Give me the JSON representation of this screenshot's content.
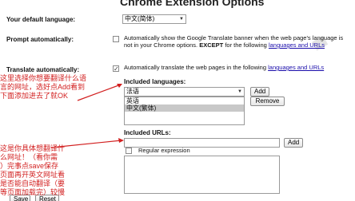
{
  "page_title": "Chrome Extension Options",
  "default_language": {
    "label": "Your default language:",
    "value": "中文(简体)"
  },
  "prompt_auto": {
    "label": "Prompt automatically:",
    "checked": false,
    "text_before": "Automatically show the Google Translate banner when the web page's language is not in your Chrome options. ",
    "emph": "EXCEPT",
    "text_mid": " for the following ",
    "link": "languages and URLs"
  },
  "translate_auto": {
    "label": "Translate automatically:",
    "checked": true,
    "text": "Automatically translate the web pages in the following ",
    "link": "languages and URLs"
  },
  "included_languages": {
    "heading": "Included languages:",
    "select_value": "法语",
    "add_button": "Add",
    "remove_button": "Remove",
    "list": [
      {
        "label": "英语",
        "selected": false
      },
      {
        "label": "中文(繁体)",
        "selected": true
      }
    ]
  },
  "included_urls": {
    "heading": "Included URLs:",
    "add_button": "Add",
    "regex_label": "Regular expression",
    "regex_checked": false
  },
  "footer": {
    "save_button": "Save",
    "reset_button": "Reset"
  },
  "annotations": {
    "top_note_lines": [
      "这里选择你想要翻译什么语",
      "言的网址，选好点Add看到",
      "下面添加进去了就OK"
    ],
    "bottom_note_lines": [
      "这是你具体想翻译什",
      "么网址！（看你需",
      "）完事点save保存",
      "页面再开英文网址看",
      "是否能自动翻译（要",
      "等页面加载完）较慢"
    ]
  },
  "colors": {
    "annotation": "#d21f1f",
    "link": "#1a0dab",
    "selected_row": "#c8c8c8"
  }
}
